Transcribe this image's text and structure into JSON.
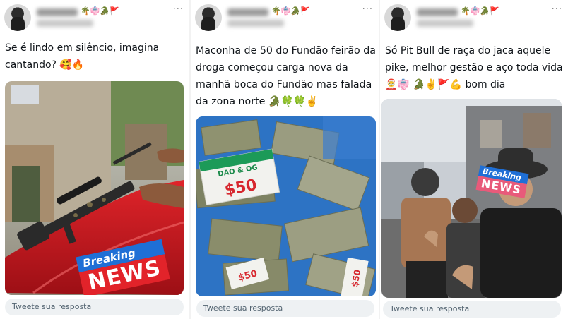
{
  "posts": [
    {
      "emojis": "🌴👘🐊🚩",
      "text": "Se é lindo em silêncio, imagina cantando? 🥰🔥",
      "badge": {
        "top": "Breaking",
        "bottom": "NEWS"
      },
      "reply_placeholder": "Tweete sua resposta"
    },
    {
      "emojis": "🌴👘🐊🚩",
      "text": "Maconha de 50 do Fundão feirão da droga começou carga nova da manhã boca do Fundão mas falada da zona norte 🐊🍀🍀✌️",
      "price_label": "$50",
      "package_text": "DAO & OG",
      "reply_placeholder": "Tweete sua resposta"
    },
    {
      "emojis": "🌴👘🐊🚩",
      "text": "Só Pit Bull de raça do jaca aquele pike, melhor gestão e aço toda vida 🤶👘 🐊✌️🚩💪 bom dia",
      "badge": {
        "top": "Breaking",
        "bottom": "NEWS"
      },
      "reply_placeholder": "Tweete sua resposta"
    }
  ],
  "more_label": "···"
}
